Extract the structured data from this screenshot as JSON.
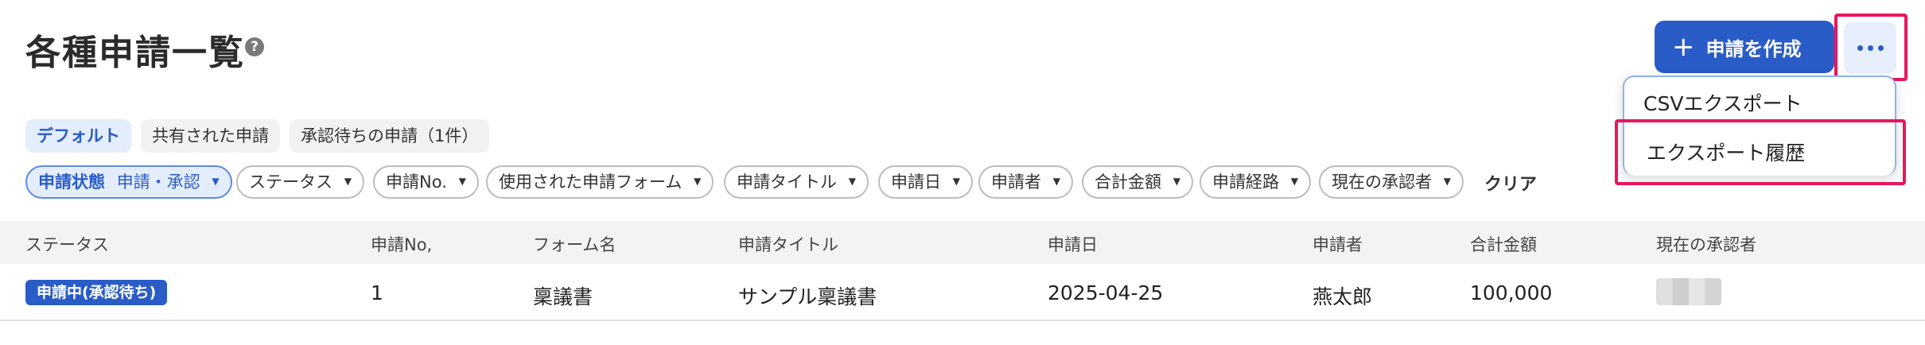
{
  "header": {
    "title": "各種申請一覧",
    "help_icon": "?",
    "create_button_label": "申請を作成",
    "create_icon": "+",
    "more_icon": "ellipsis-icon"
  },
  "menu": {
    "items": [
      {
        "label": "CSVエクスポート"
      },
      {
        "label": "エクスポート履歴"
      }
    ]
  },
  "views": [
    {
      "label": "デフォルト",
      "active": true
    },
    {
      "label": "共有された申請",
      "active": false
    },
    {
      "label": "承認待ちの申請（1件）",
      "active": false
    }
  ],
  "filters": {
    "chips": [
      {
        "label": "申請状態",
        "value": "申請・承認",
        "active": true
      },
      {
        "label": "ステータス"
      },
      {
        "label": "申請No."
      },
      {
        "label": "使用された申請フォーム"
      },
      {
        "label": "申請タイトル"
      },
      {
        "label": "申請日"
      },
      {
        "label": "申請者"
      },
      {
        "label": "合計金額"
      },
      {
        "label": "申請経路"
      },
      {
        "label": "現在の承認者"
      }
    ],
    "clear_label": "クリア",
    "caret": "▼"
  },
  "table": {
    "columns": [
      "ステータス",
      "申請No,",
      "フォーム名",
      "申請タイトル",
      "申請日",
      "申請者",
      "合計金額",
      "現在の承認者"
    ],
    "rows": [
      {
        "status": "申請中(承認待ち)",
        "no": "1",
        "form": "稟議書",
        "title": "サンプル稟議書",
        "date": "2025-04-25",
        "applicant": "燕太郎",
        "amount": "100,000"
      }
    ]
  },
  "colors": {
    "accent": "#2a5cc8",
    "highlight": "#e8175d"
  }
}
